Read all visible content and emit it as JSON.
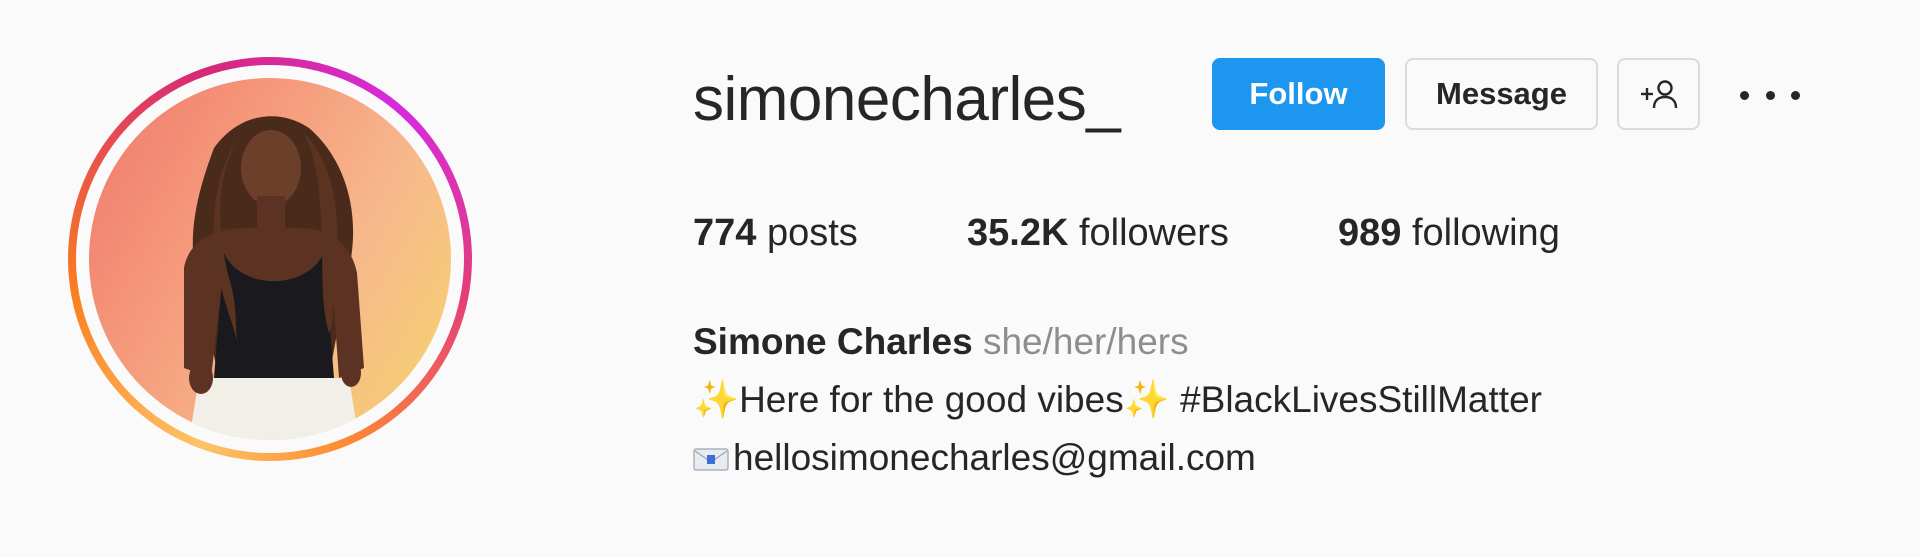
{
  "profile": {
    "username": "simonecharles_",
    "follow_label": "Follow",
    "message_label": "Message",
    "stats": {
      "posts_count": "774",
      "posts_label": " posts",
      "followers_count": "35.2K",
      "followers_label": " followers",
      "following_count": "989",
      "following_label": " following"
    },
    "bio": {
      "name": "Simone Charles",
      "pronouns": "she/her/hers",
      "line1_sparkle_left": "✨",
      "line1_text": "Here for the good vibes",
      "line1_sparkle_right": "✨",
      "line1_hashtag": " #BlackLivesStillMatter",
      "email": "hellosimonecharles@gmail.com"
    }
  },
  "colors": {
    "follow_button": "#1d96f0",
    "text_primary": "#262626",
    "text_secondary": "#8e8e8e",
    "border": "#dbdbdb",
    "background": "#fafafa"
  },
  "icons": {
    "suggest": "add-person-icon",
    "more": "more-options-icon",
    "email": "envelope-emoji-icon"
  }
}
